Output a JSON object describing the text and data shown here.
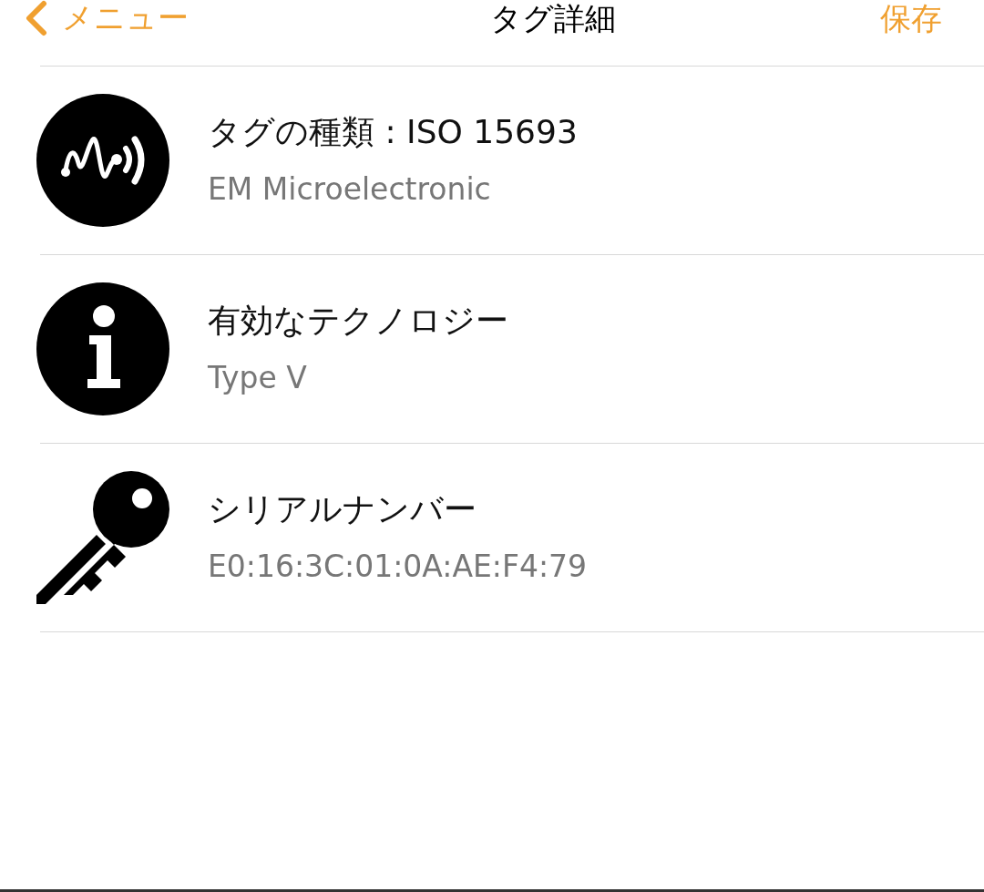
{
  "nav_bar": {
    "back_label": "メニュー",
    "title": "タグ詳細",
    "action": "保存"
  },
  "rows": [
    {
      "kind": "signal",
      "title": "タグの種類 : ISO 15693",
      "detail": "EM Microelectronic"
    },
    {
      "kind": "info",
      "title": "有効なテクノロジー",
      "detail": "Type V"
    },
    {
      "kind": "key",
      "title": "シリアルナンバー",
      "detail": "E0:16:3C:01:0A:AE:F4:79"
    }
  ]
}
